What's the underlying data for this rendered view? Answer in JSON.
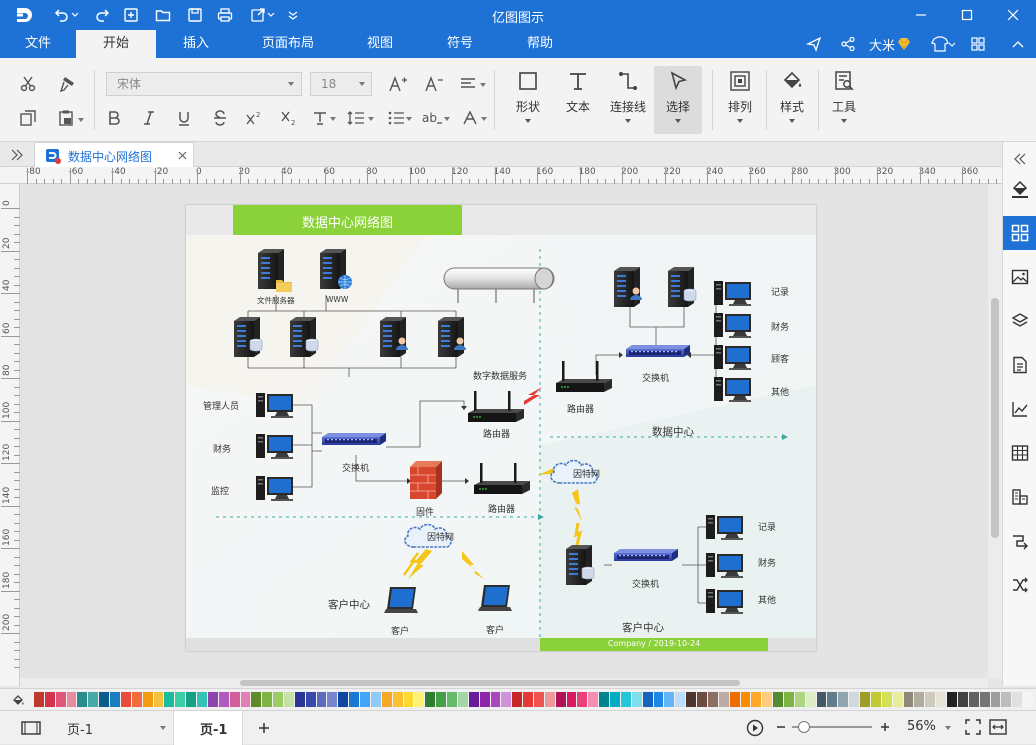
{
  "app": {
    "title": "亿图图示"
  },
  "menu": {
    "items": [
      "文件",
      "开始",
      "插入",
      "页面布局",
      "视图",
      "符号",
      "帮助"
    ],
    "active_index": 1,
    "user_name": "大米"
  },
  "toolbar": {
    "font_name": "宋体",
    "font_size": "18",
    "shape_label": "形状",
    "text_label": "文本",
    "connector_label": "连接线",
    "select_label": "选择",
    "arrange_label": "排列",
    "style_label": "样式",
    "tools_label": "工具"
  },
  "document": {
    "tab_title": "数据中心网络图"
  },
  "ruler": {
    "h_ticks": [
      "-80",
      "-60",
      "-40",
      "-20",
      "0",
      "20",
      "40",
      "60",
      "80",
      "100",
      "120",
      "140",
      "160",
      "180",
      "200",
      "220",
      "240",
      "260",
      "280",
      "300",
      "320",
      "340",
      "360"
    ],
    "v_ticks": [
      "0",
      "20",
      "40",
      "60",
      "80",
      "100",
      "120",
      "140",
      "160",
      "180",
      "200"
    ]
  },
  "diagram": {
    "title": "数据中心网络图",
    "footer": "Company / 2019-10-24",
    "labels": {
      "file_server": "文件服务器",
      "www": "WWW",
      "data_service": "数字数据服务",
      "admin": "管理人员",
      "finance_left": "财务",
      "monitor": "监控",
      "switch_left": "交换机",
      "router_upper": "路由器",
      "router_lower": "路由器",
      "router_right": "路由器",
      "firewall": "固件",
      "internet_left": "因特网",
      "internet_right": "因特网",
      "customer_center_left": "客户中心",
      "client_1": "客户",
      "client_2": "客户",
      "data_center": "数据中心",
      "switch_top_right": "交换机",
      "record_top": "记录",
      "finance_top": "财务",
      "customer_top": "顾客",
      "other_top": "其他",
      "switch_bottom_right": "交换机",
      "record_bottom": "记录",
      "finance_bottom": "财务",
      "other_bottom": "其他",
      "customer_center_right": "客户中心"
    }
  },
  "status": {
    "page_selector": "页-1",
    "page_tab": "页-1",
    "zoom": "56%"
  },
  "palette": {
    "colors": [
      "#c0392b",
      "#d4334c",
      "#e0567a",
      "#e88aa0",
      "#2c8c8c",
      "#45aaa8",
      "#0a5e8c",
      "#1c7cc0",
      "#e74c3c",
      "#f26b3a",
      "#f39c12",
      "#f6c23e",
      "#1abc9c",
      "#3ccfa5",
      "#16a085",
      "#34c3b7",
      "#8e44ad",
      "#b05ac0",
      "#d35d9b",
      "#e37fb3",
      "#5e8a2a",
      "#7cb342",
      "#9ccc65",
      "#c5e1a5",
      "#283593",
      "#3949ab",
      "#5c6bc0",
      "#7986cb",
      "#0d47a1",
      "#1976d2",
      "#42a5f5",
      "#90caf9",
      "#f9a825",
      "#fbc02d",
      "#fdd835",
      "#fff176",
      "#2e7d32",
      "#43a047",
      "#66bb6a",
      "#a5d6a7",
      "#6a1b9a",
      "#8e24aa",
      "#ab47bc",
      "#ce93d8",
      "#c62828",
      "#e53935",
      "#ef5350",
      "#ef9a9a",
      "#ad1457",
      "#d81b60",
      "#ec407a",
      "#f48fb1",
      "#00838f",
      "#00acc1",
      "#26c6da",
      "#80deea",
      "#1565c0",
      "#1e88e5",
      "#64b5f6",
      "#bbdefb",
      "#4e342e",
      "#6d4c41",
      "#8d6e63",
      "#bcaaa4",
      "#ef6c00",
      "#fb8c00",
      "#ffa726",
      "#ffcc80",
      "#558b2f",
      "#7cb342",
      "#aed581",
      "#dcedc8",
      "#455a64",
      "#607d8b",
      "#90a4ae",
      "#cfd8dc",
      "#9e9d24",
      "#c0ca33",
      "#d4e157",
      "#e6ee9c",
      "#8d8a7c",
      "#b0ad9e",
      "#cfcbbd",
      "#e6e3d8",
      "#212121",
      "#424242",
      "#616161",
      "#757575",
      "#9e9e9e",
      "#bdbdbd",
      "#e0e0e0",
      "#f5f5f5"
    ]
  }
}
